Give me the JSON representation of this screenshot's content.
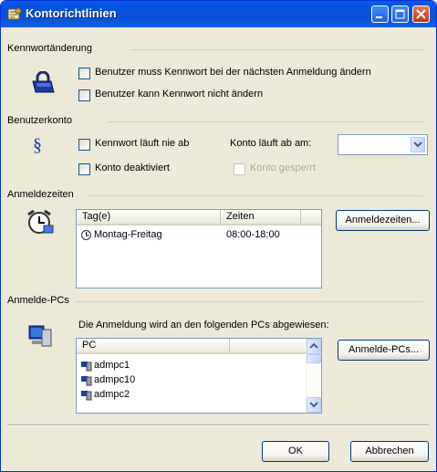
{
  "window": {
    "title": "Kontorichtlinien"
  },
  "password_group": {
    "title": "Kennwortänderung",
    "must_change": "Benutzer muss Kennwort bei der nächsten Anmeldung ändern",
    "cannot_change": "Benutzer kann Kennwort nicht ändern"
  },
  "account_group": {
    "title": "Benutzerkonto",
    "never_expires": "Kennwort läuft nie ab",
    "disabled": "Konto deaktiviert",
    "expires_label": "Konto läuft ab am:",
    "expires_value": "",
    "locked": "Konto gesperrt"
  },
  "logon_times": {
    "title": "Anmeldezeiten",
    "col_day": "Tag(e)",
    "col_time": "Zeiten",
    "rows": [
      {
        "day": "Montag-Freitag",
        "time": "08:00-18:00"
      }
    ],
    "button": "Anmeldezeiten..."
  },
  "logon_pcs": {
    "title": "Anmelde-PCs",
    "description": "Die Anmeldung wird an den folgenden PCs abgewiesen:",
    "col_pc": "PC",
    "rows": [
      "admpc1",
      "admpc10",
      "admpc2"
    ],
    "button": "Anmelde-PCs..."
  },
  "footer": {
    "ok": "OK",
    "cancel": "Abbrechen"
  }
}
